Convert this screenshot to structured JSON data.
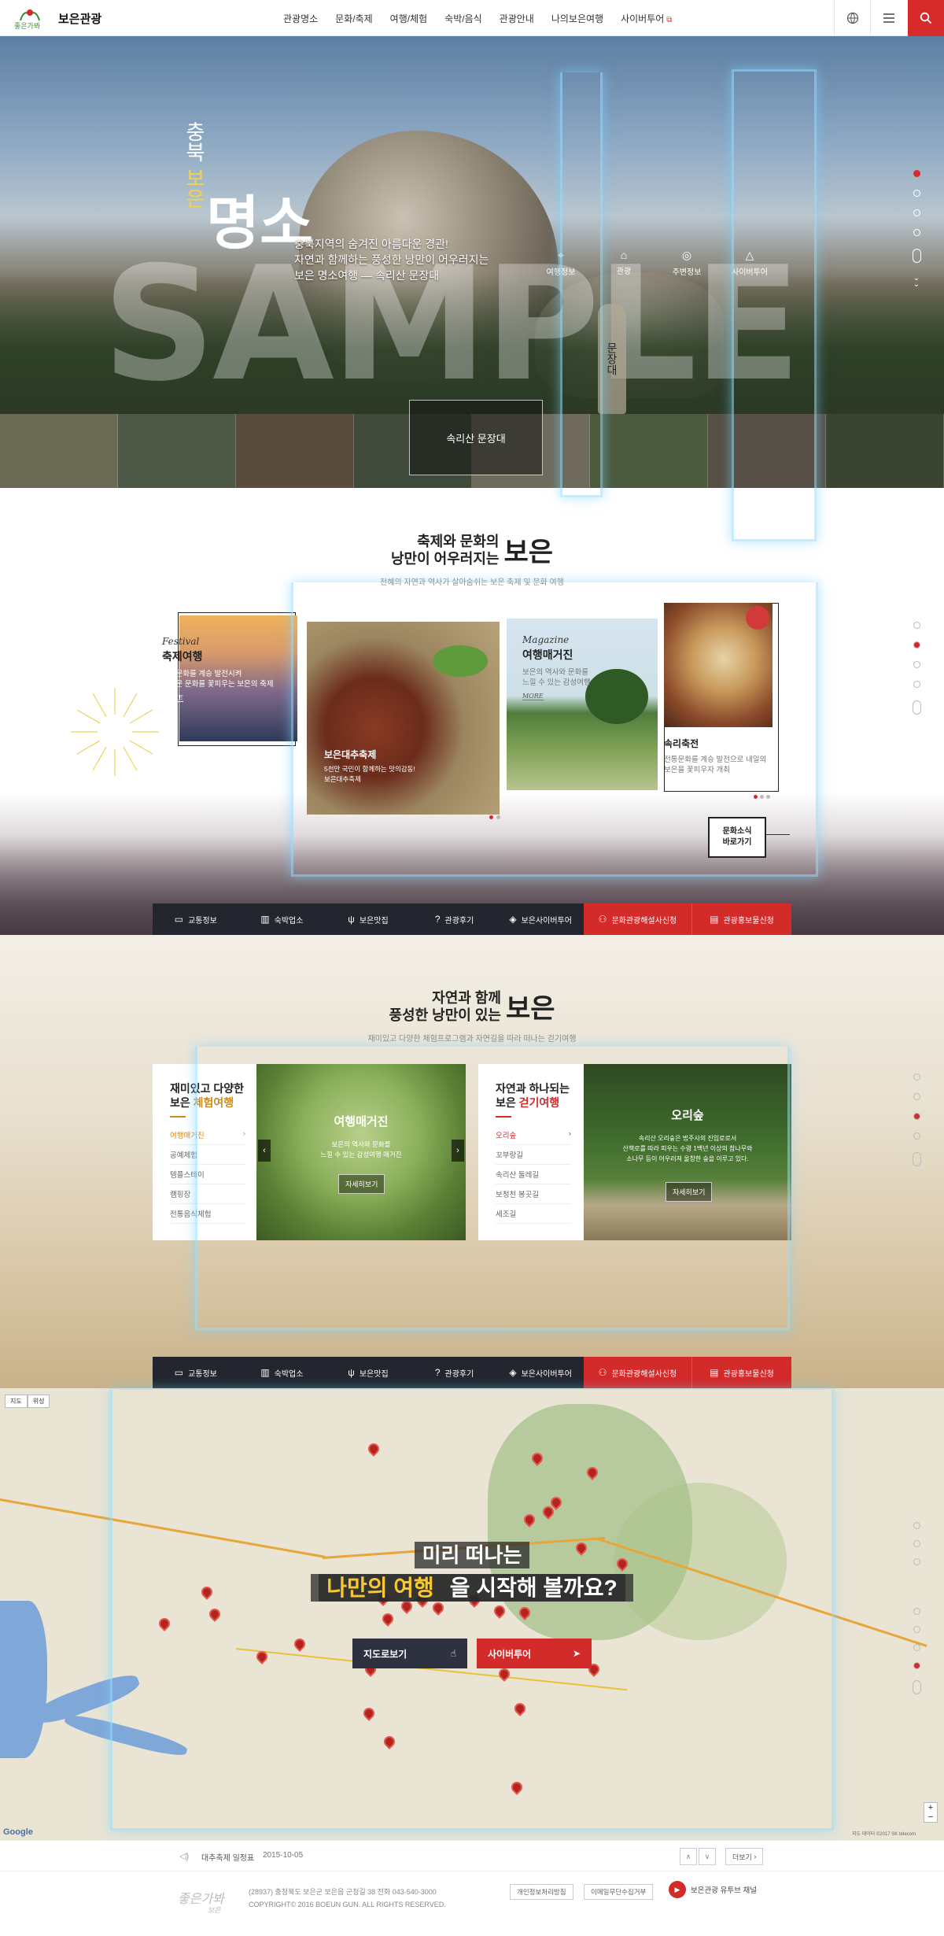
{
  "header": {
    "brand": "보은관광",
    "logo_mark": "좋은가봐 보은",
    "nav": [
      "관광명소",
      "문화/축제",
      "여행/체험",
      "숙박/음식",
      "관광안내",
      "나의보은여행",
      "사이버투어"
    ],
    "icons": {
      "lang": "globe-icon",
      "menu": "hamburger-icon",
      "search": "search-icon"
    },
    "accent": "#d72a2a"
  },
  "hero": {
    "vertical_title": [
      "충북",
      "보은"
    ],
    "big_title": "명소",
    "desc": [
      "충북지역의 숨겨진 아름다운 경관!",
      "자연과 함께하는 풍성한 낭만이 어우러지는",
      "보은 명소여행 — 속리산 문장대"
    ],
    "quick": [
      "여행정보",
      "관광",
      "주변정보",
      "사이버투어"
    ],
    "stele": "문장대",
    "caption": "속리산 문장대",
    "watermark": "SAMPLE"
  },
  "festival": {
    "title_line1": "축제와 문화의",
    "title_line2": "낭만이 어우러지는",
    "title_big": "보은",
    "subtitle": "천혜의 자연과 역사가 살아숨쉬는 보은 축제 및 문화 여행",
    "card1": {
      "label": "Festival",
      "title": "축제여행",
      "desc": [
        "전통문화를 계승 발전시켜",
        "새로운 문화를 꽃피우는 보은의 축제"
      ],
      "more": "MORE"
    },
    "card2": {
      "title": "보은대추축제",
      "desc": [
        "5천만 국민이 함께하는 맛의감동!",
        "보은대추축제"
      ]
    },
    "card3": {
      "label": "Magazine",
      "title": "여행매거진",
      "desc": [
        "보은의 역사와 문화를",
        "느낄 수 있는 감성여행"
      ],
      "more": "MORE"
    },
    "card4": {
      "title": "속리축전",
      "desc": [
        "전통문화를 계승 발전으로 내일의",
        "보은을 꽃피우자 개최"
      ]
    },
    "culture_btn": [
      "문화소식",
      "바로가기"
    ]
  },
  "quicklinks": [
    {
      "icon": "bus-icon",
      "label": "교통정보"
    },
    {
      "icon": "building-icon",
      "label": "숙박업소"
    },
    {
      "icon": "cutlery-icon",
      "label": "보은맛집"
    },
    {
      "icon": "question-icon",
      "label": "관광후기"
    },
    {
      "icon": "compass-icon",
      "label": "보은사이버투어"
    },
    {
      "icon": "user-plus-icon",
      "label": "문화관광해설사신청"
    },
    {
      "icon": "book-icon",
      "label": "관광홍보물신청"
    }
  ],
  "nature": {
    "title_line1": "자연과 함께",
    "title_line2": "풍성한 낭만이 있는",
    "title_big": "보은",
    "subtitle": "재미있고 다양한 체험프로그램과 자연길을 따라 떠나는 걷기여행",
    "left_panel": {
      "head1": "재미있고 다양한",
      "head2_pre": "보은 ",
      "head2_hl": "체험여행",
      "items": [
        "여행매거진",
        "공예체험",
        "템플스테이",
        "캠핑장",
        "전통음식체험"
      ],
      "image_title": "여행매거진",
      "image_desc": [
        "보은의 역사와 문화를",
        "느낄 수 있는 감성여행 매거진"
      ],
      "image_btn": "자세히보기"
    },
    "right_panel": {
      "head1": "자연과 하나되는",
      "head2_pre": "보은 ",
      "head2_hl": "걷기여행",
      "items": [
        "오리숲",
        "꼬부랑길",
        "속리산 둘레길",
        "보청천 봉곳길",
        "세조길"
      ],
      "image_title": "오리숲",
      "image_desc": [
        "속리산 오리숲은 법주사의 진입로로서",
        "산책로를 따라 피우는 수령 1백년 이상의 참나무와",
        "소나무 등이 어우러져 울창한 숲을 이루고 있다."
      ],
      "image_btn": "자세히보기"
    }
  },
  "map": {
    "headline1": "미리 떠나는",
    "headline2_hl": "나만의 여행",
    "headline2_rest": "을 시작해 볼까요?",
    "btn1": "지도로보기",
    "btn2": "사이버투어",
    "types": [
      "지도",
      "위성"
    ],
    "google": "Google",
    "copyright": "지도 데이터 ©2017 SK telecom"
  },
  "notice": {
    "title": "대추축제 일정표",
    "date": "2015-10-05",
    "more": "더보기"
  },
  "footer": {
    "logo": "좋은가봐 보은",
    "address": "(28937) 충청북도 보은군 보은읍 군청길 38    전화 043-540-3000",
    "copyright": "COPYRIGHT© 2016 BOEUN GUN. ALL RIGHTS RESERVED.",
    "links": [
      "개인정보처리방침",
      "이메일무단수집거부"
    ],
    "youtube": "보은관광 유투브 채널"
  }
}
